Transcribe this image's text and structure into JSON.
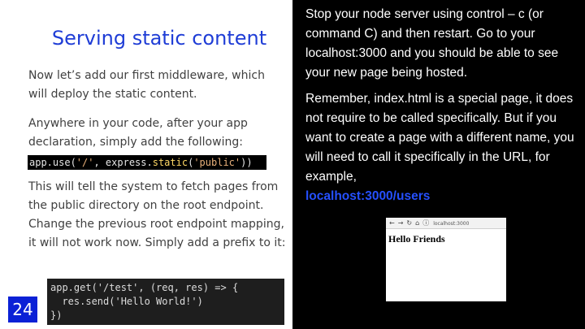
{
  "left": {
    "title": "Serving static content",
    "para1": "Now let’s add our first middleware, which will deploy the static content.",
    "para2": "Anywhere in your code, after your app declaration, simply add the following:",
    "code1": {
      "part1": "app.use(",
      "part2": "'/'",
      "part3": ", express.",
      "part4": "static",
      "part5": "(",
      "part6": "'public'",
      "part7": "))"
    },
    "para3": "This will tell the system to fetch pages from the public directory on the root endpoint. Change the previous root endpoint mapping, it will not work now. Simply add a prefix to it:",
    "code2": {
      "line1": "app.get('/test', (req, res) => {",
      "line2": "  res.send('Hello World!')",
      "line3": "})"
    },
    "slide_number": "24"
  },
  "right": {
    "para1": "Stop your node server using control – c (or command C) and then restart. Go to your localhost:3000 and you should be able to see your new page being hosted.",
    "para2": "Remember, index.html is a special page, it does not require to be called specifically. But if you want to create a page with a different name, you will need to call it specifically in the URL, for example,",
    "link": "localhost:3000/users",
    "browser": {
      "back_icon": "arrow-left-icon",
      "forward_icon": "arrow-right-icon",
      "reload_icon": "reload-icon",
      "home_icon": "home-icon",
      "info_icon": "info-icon",
      "url": "localhost:3000",
      "content": "Hello Friends"
    }
  }
}
